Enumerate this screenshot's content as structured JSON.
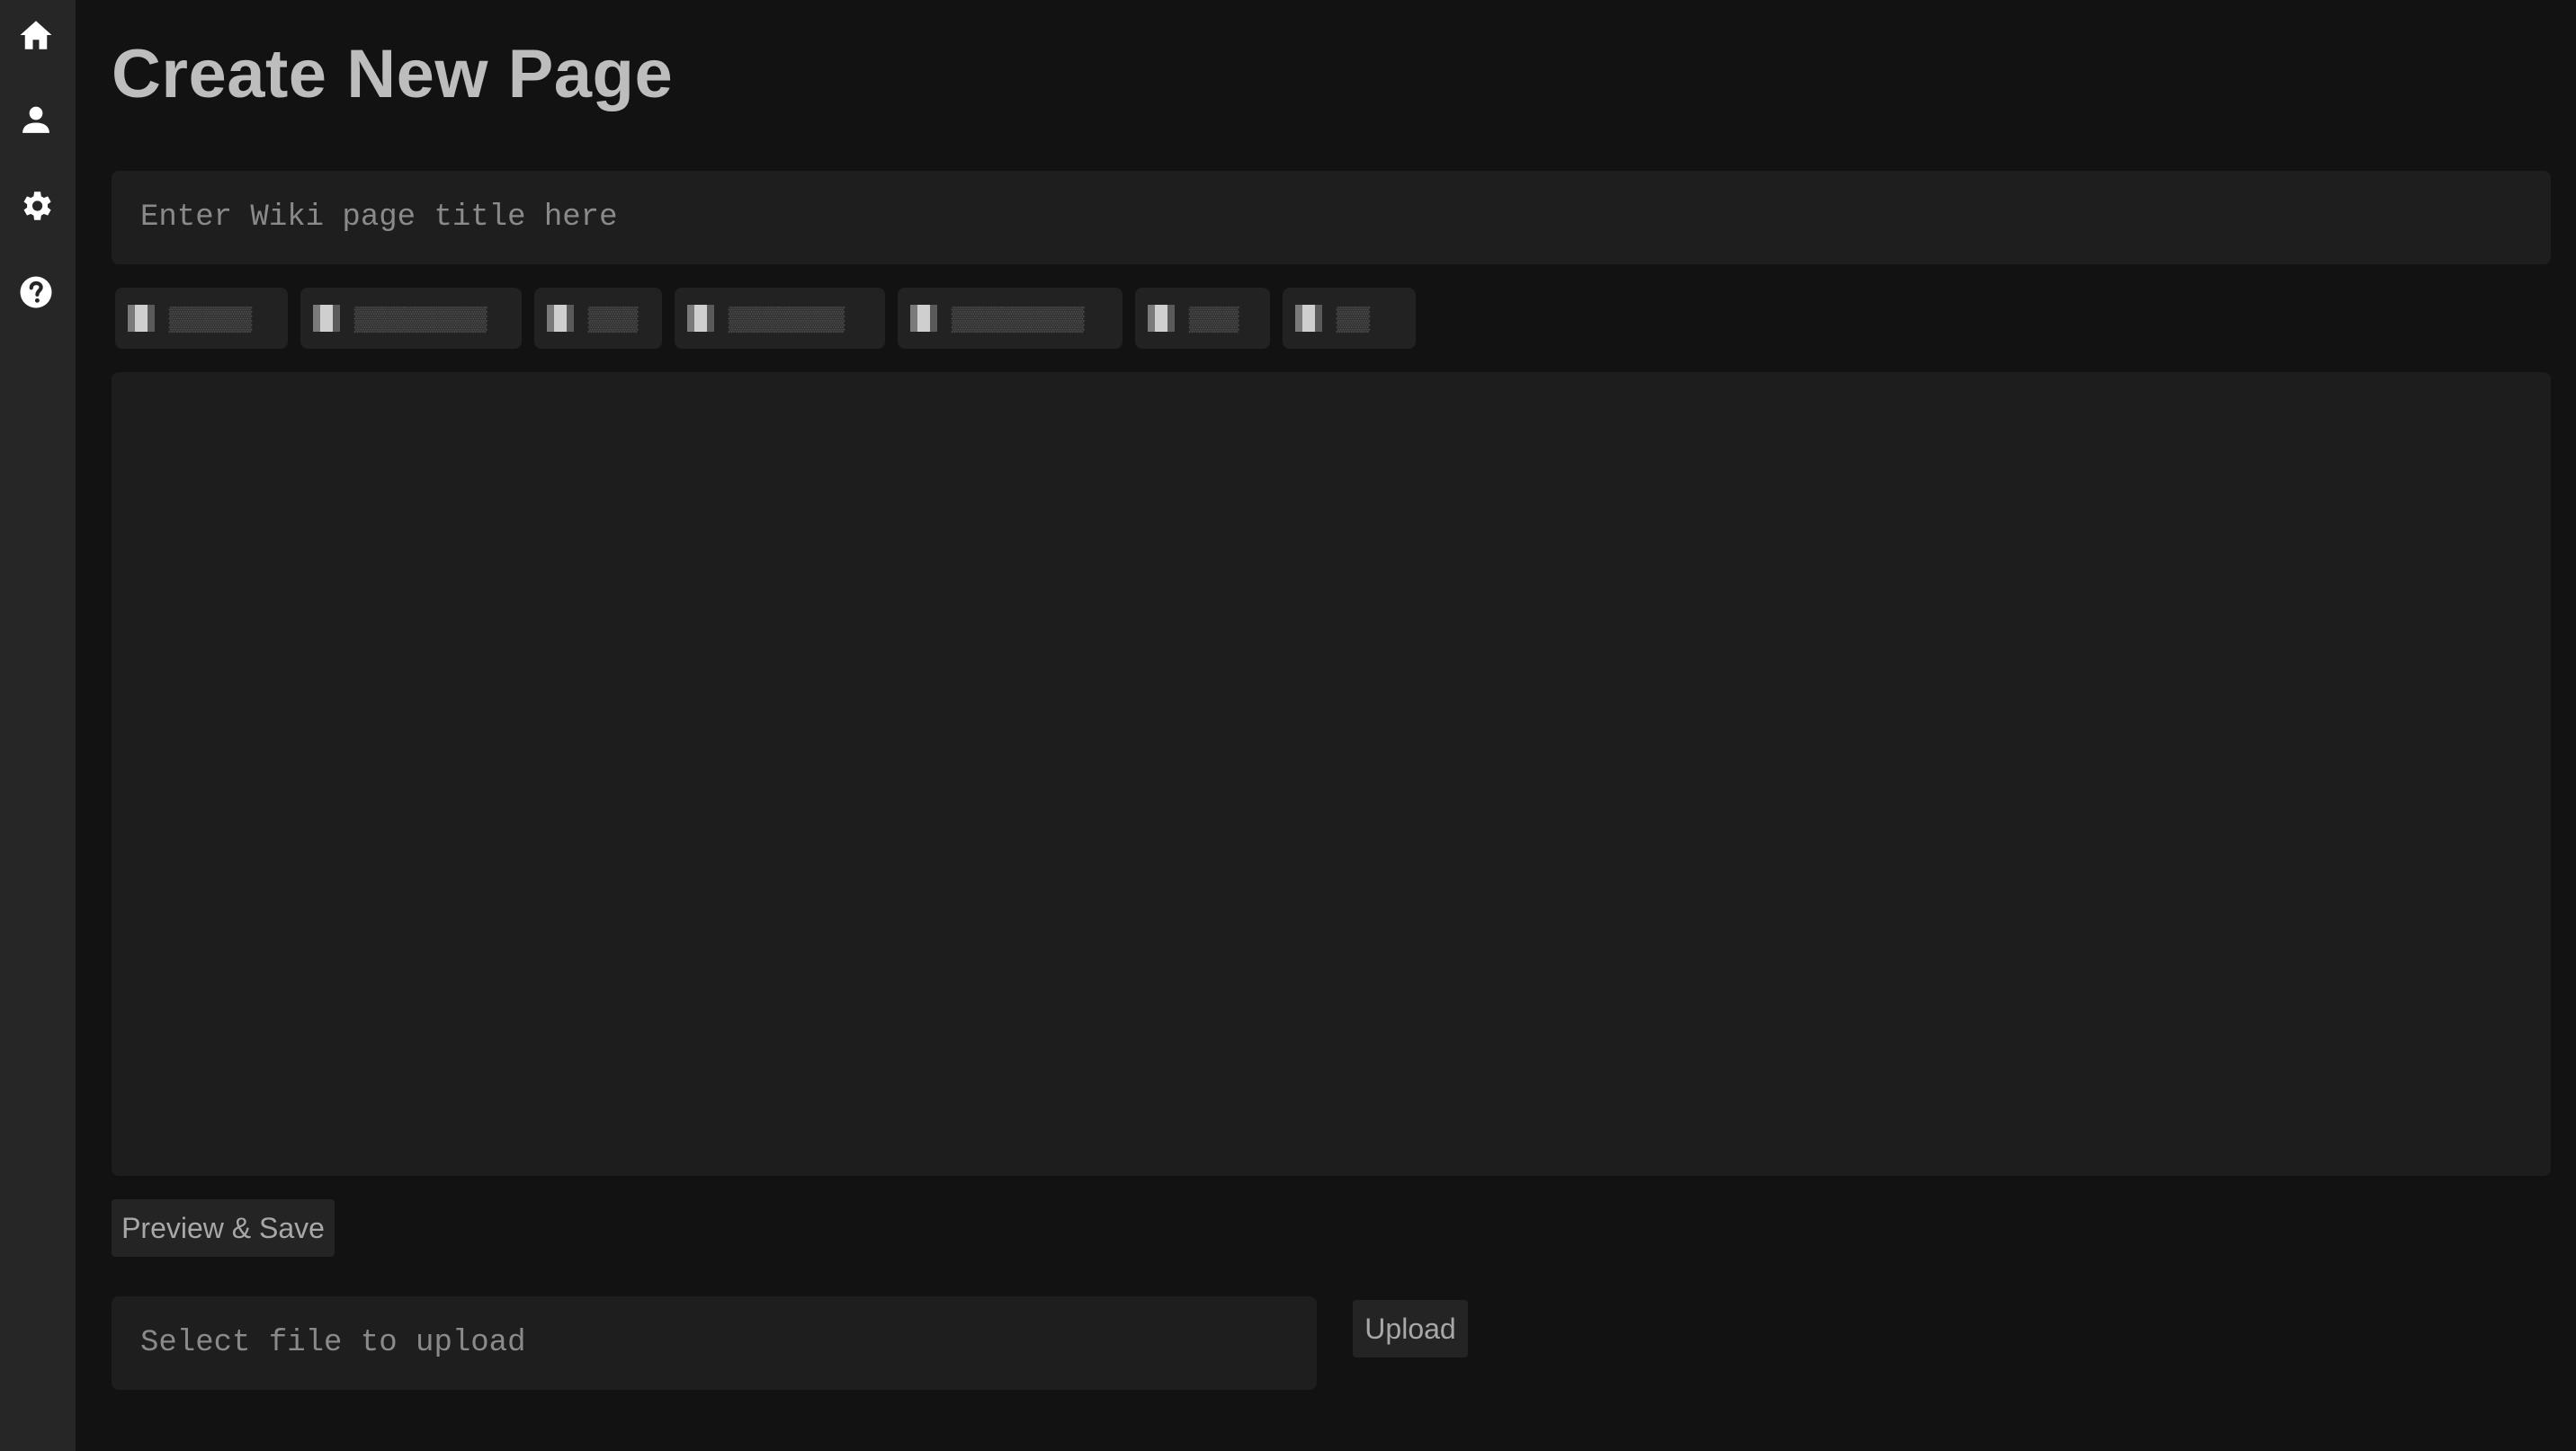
{
  "sidebar": {
    "items": [
      {
        "icon": "home-icon",
        "label": "Home"
      },
      {
        "icon": "person-icon",
        "label": "Profile"
      },
      {
        "icon": "gear-icon",
        "label": "Settings"
      },
      {
        "icon": "help-icon",
        "label": "Help"
      }
    ]
  },
  "page": {
    "title": "Create New Page"
  },
  "title_input": {
    "placeholder": "Enter Wiki page title here",
    "value": ""
  },
  "toolbar": {
    "buttons": [
      {
        "label": "▒▒▒▒▒"
      },
      {
        "label": "▒▒▒▒▒▒▒▒"
      },
      {
        "label": "▒▒▒"
      },
      {
        "label": "▒▒▒▒▒▒▒"
      },
      {
        "label": "▒▒▒▒▒▒▒▒"
      },
      {
        "label": "▒▒▒"
      },
      {
        "label": "▒▒"
      }
    ]
  },
  "editor": {
    "value": ""
  },
  "actions": {
    "preview_save_label": "Preview & Save",
    "upload_label": "Upload"
  },
  "file_input": {
    "placeholder": "Select file to upload"
  },
  "colors": {
    "background": "#121212",
    "sidebar": "#262626",
    "field": "#1e1e1e",
    "text": "#bdbdbd"
  }
}
